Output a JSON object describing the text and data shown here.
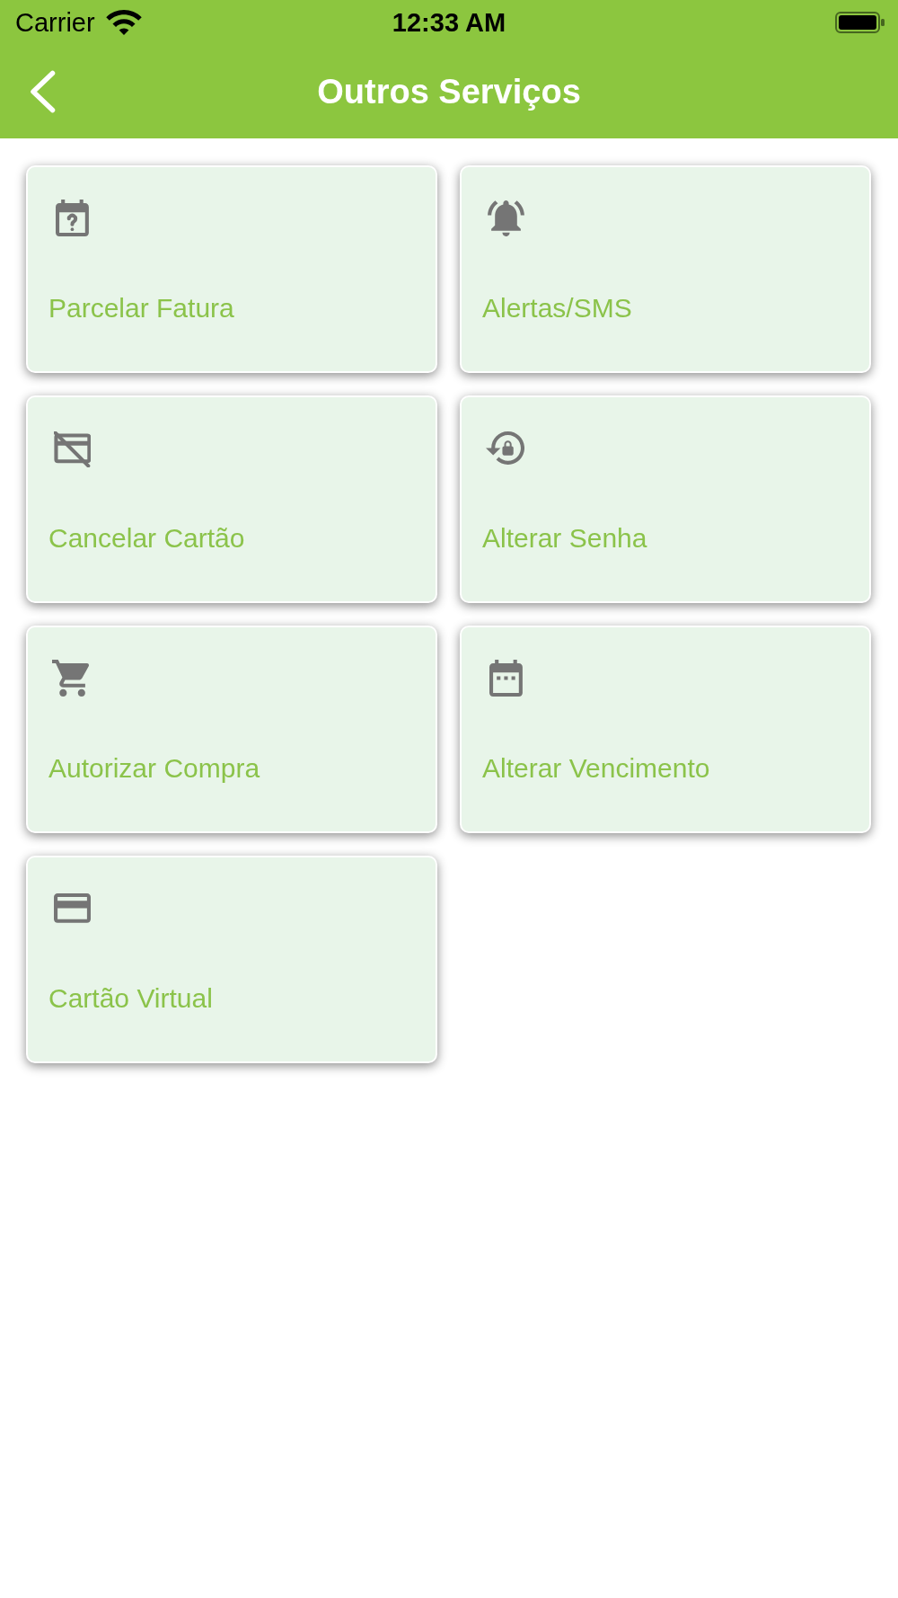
{
  "status_bar": {
    "carrier": "Carrier",
    "time": "12:33 AM"
  },
  "nav_bar": {
    "title": "Outros Serviços"
  },
  "services": [
    {
      "kind": "installments",
      "label": "Parcelar Fatura"
    },
    {
      "kind": "alerts",
      "label": "Alertas/SMS"
    },
    {
      "kind": "cancel",
      "label": "Cancelar Cartão"
    },
    {
      "kind": "password",
      "label": "Alterar Senha"
    },
    {
      "kind": "purchase",
      "label": "Autorizar Compra"
    },
    {
      "kind": "duedate",
      "label": "Alterar Vencimento"
    },
    {
      "kind": "virtual",
      "label": "Cartão Virtual"
    }
  ]
}
